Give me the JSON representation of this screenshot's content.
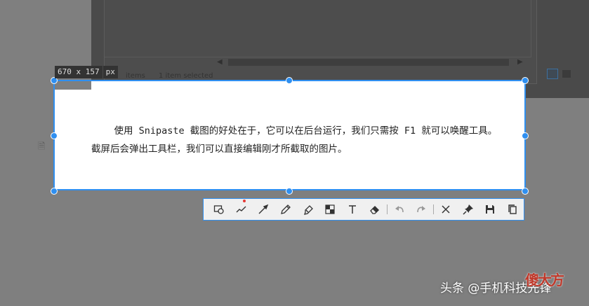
{
  "background_window": {
    "status_items": "items",
    "status_selected": "1 item selected"
  },
  "selection": {
    "size_value": "670 x 157",
    "size_unit": "px",
    "text_line1": "    使用 Snipaste 截图的好处在于，它可以在后台运行，我们只需按 F1 就可以唤醒工具。",
    "text_line2": "截屏后会弹出工具栏，我们可以直接编辑刚才所截取的图片。"
  },
  "toolbar": {
    "tools": [
      "rectangle-ellipse",
      "polyline",
      "arrow",
      "pencil",
      "marker",
      "mosaic",
      "text",
      "eraser",
      "undo",
      "redo",
      "close",
      "pin",
      "save",
      "copy"
    ]
  },
  "watermark": {
    "text": "头条 @手机科技先锋",
    "logo": "傻大方"
  },
  "colors": {
    "accent": "#2f8ff0",
    "dim": "#7f7f7f"
  }
}
